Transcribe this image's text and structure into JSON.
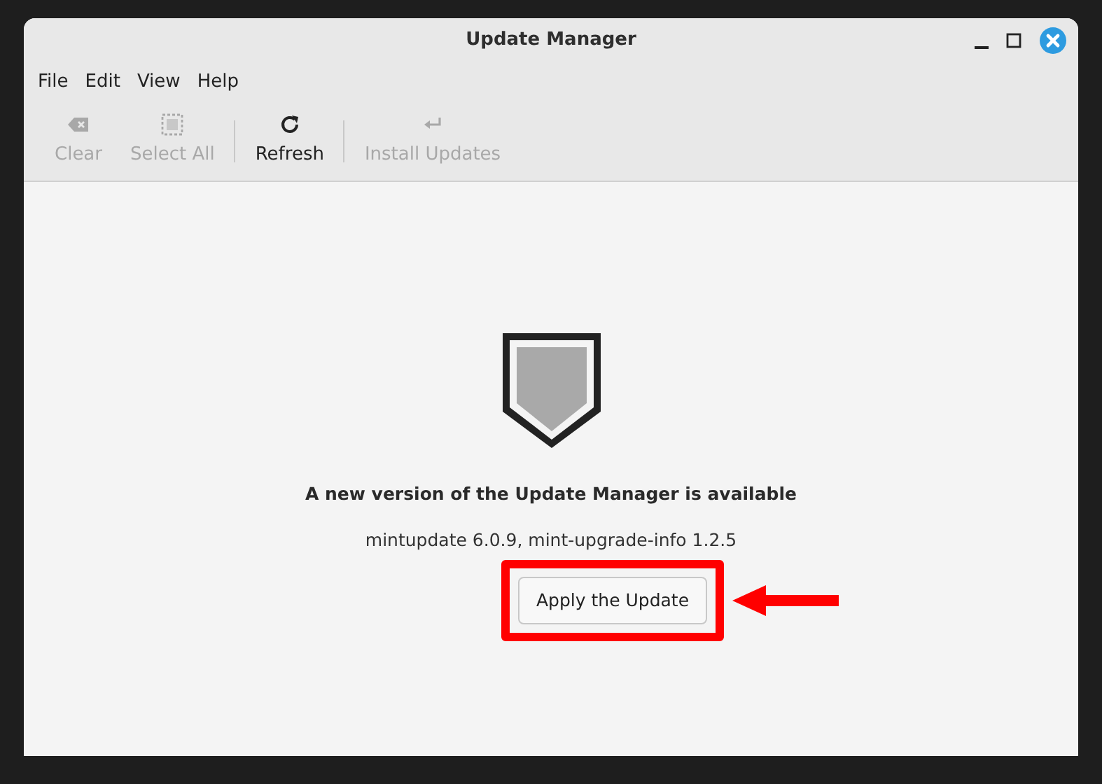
{
  "window": {
    "title": "Update Manager"
  },
  "menu": [
    "File",
    "Edit",
    "View",
    "Help"
  ],
  "toolbar": [
    {
      "label": "Clear",
      "disabled": true
    },
    {
      "label": "Select All",
      "disabled": true
    },
    {
      "label": "Refresh",
      "disabled": false
    },
    {
      "label": "Install Updates",
      "disabled": true
    }
  ],
  "message": {
    "heading": "A new version of the Update Manager is available",
    "detail": "mintupdate 6.0.9, mint-upgrade-info 1.2.5",
    "button": "Apply the Update"
  }
}
